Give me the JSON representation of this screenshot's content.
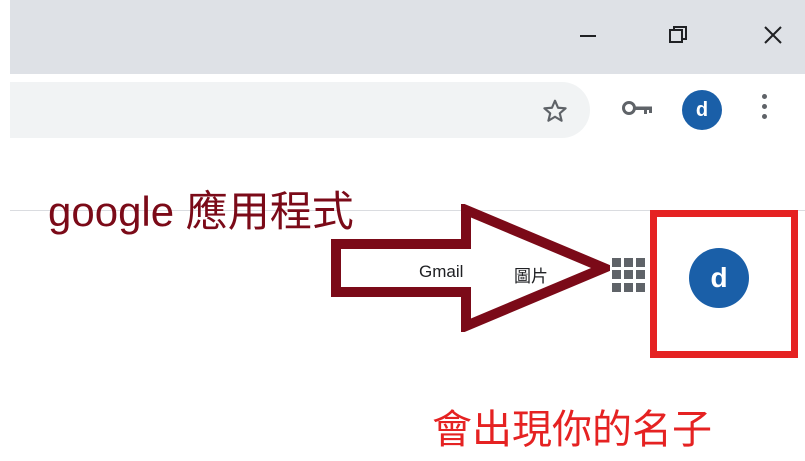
{
  "window_controls": {
    "minimize_icon": "minimize-icon",
    "restore_icon": "restore-icon",
    "close_icon": "close-icon"
  },
  "toolbar": {
    "star_icon": "star-icon",
    "key_icon": "key-icon",
    "profile_initial": "d",
    "menu_icon": "vertical-dots-icon"
  },
  "google_bar": {
    "gmail_label": "Gmail",
    "images_label": "圖片",
    "apps_icon": "apps-grid-icon",
    "account_initial": "d"
  },
  "annotations": {
    "apps_note": "google 應用程式",
    "name_note": "會出現你的名子",
    "arrow_color": "#7b0a18",
    "highlight_color": "#e52222"
  },
  "colors": {
    "avatar_blue": "#1a5fa8",
    "titlebar": "#dee1e6",
    "omnibox": "#f1f3f4"
  }
}
